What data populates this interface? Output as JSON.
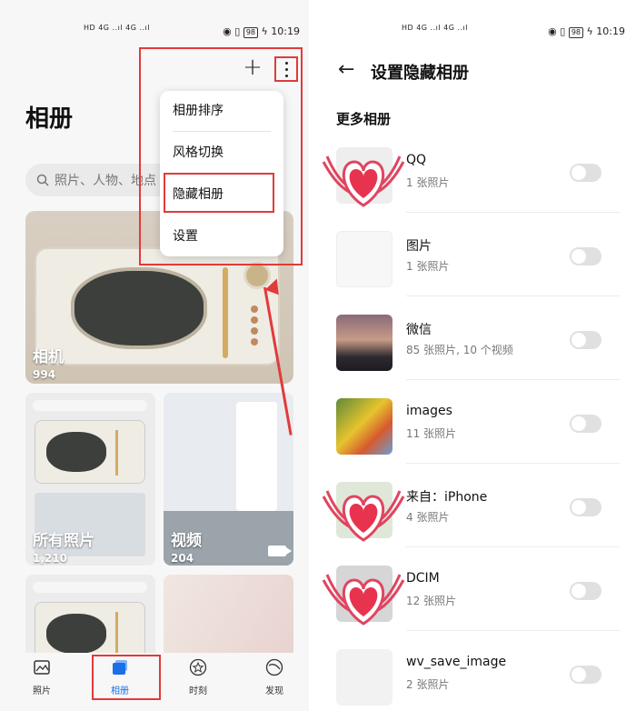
{
  "left_screen": {
    "status": {
      "time": "10:19",
      "battery": "98",
      "signal": "HD 4G ..ıl 4G ..ıl"
    },
    "toolbar": {
      "plus_label": "+"
    },
    "title": "相册",
    "search": {
      "placeholder": "照片、人物、地点"
    },
    "menu": {
      "items": [
        "相册排序",
        "风格切换",
        "隐藏相册",
        "设置"
      ]
    },
    "albums": [
      {
        "name": "相机",
        "count": "994"
      },
      {
        "name": "所有照片",
        "count": "1,210"
      },
      {
        "name": "视频",
        "count": "204"
      }
    ],
    "nav": [
      {
        "label": "照片",
        "icon": "image-icon"
      },
      {
        "label": "相册",
        "icon": "album-icon"
      },
      {
        "label": "时刻",
        "icon": "star-icon"
      },
      {
        "label": "发现",
        "icon": "discover-icon"
      }
    ],
    "colors": {
      "accent": "#1a6fe8",
      "annotation": "#e23a3a"
    }
  },
  "right_screen": {
    "status": {
      "time": "10:19",
      "battery": "98"
    },
    "back_icon": "arrow-left-icon",
    "title": "设置隐藏相册",
    "section": "更多相册",
    "albums": [
      {
        "name": "QQ",
        "count": "1 张照片"
      },
      {
        "name": "图片",
        "count": "1 张照片"
      },
      {
        "name": "微信",
        "count": "85 张照片, 10 个视频"
      },
      {
        "name": "images",
        "count": "11 张照片"
      },
      {
        "name": "来自：iPhone",
        "count": "4 张照片"
      },
      {
        "name": "DCIM",
        "count": "12 张照片"
      },
      {
        "name": "wv_save_image",
        "count": "2 张照片"
      }
    ]
  }
}
